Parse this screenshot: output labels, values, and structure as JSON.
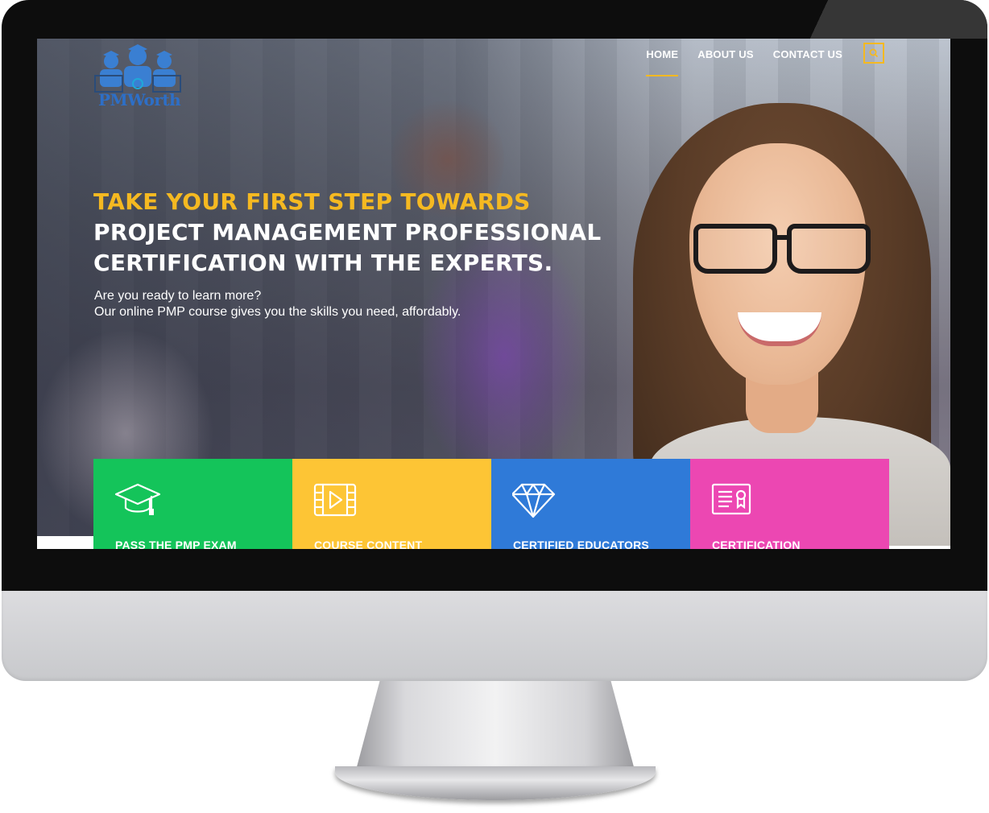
{
  "logo": {
    "text": "PMWorth"
  },
  "nav": {
    "items": [
      {
        "label": "HOME",
        "active": true
      },
      {
        "label": "ABOUT US",
        "active": false
      },
      {
        "label": "CONTACT US",
        "active": false
      }
    ],
    "search_icon": "search-icon"
  },
  "hero": {
    "headline_accent": "TAKE YOUR FIRST STEP TOWARDS",
    "headline_line2": "PROJECT MANAGEMENT PROFESSIONAL",
    "headline_line3": "CERTIFICATION WITH THE EXPERTS.",
    "subtext_line1": "Are you ready to learn more?",
    "subtext_line2": "Our online PMP course gives you the skills you need, affordably."
  },
  "features": [
    {
      "label": "PASS THE PMP EXAM",
      "icon": "graduation-cap-icon",
      "color": "#14c45a"
    },
    {
      "label": "COURSE CONTENT",
      "icon": "video-film-icon",
      "color": "#fdc535"
    },
    {
      "label": "CERTIFIED EDUCATORS",
      "icon": "diamond-icon",
      "color": "#2f7ad8"
    },
    {
      "label": "CERTIFICATION",
      "icon": "certificate-icon",
      "color": "#ec47b2"
    }
  ],
  "colors": {
    "accent": "#f5b921"
  }
}
